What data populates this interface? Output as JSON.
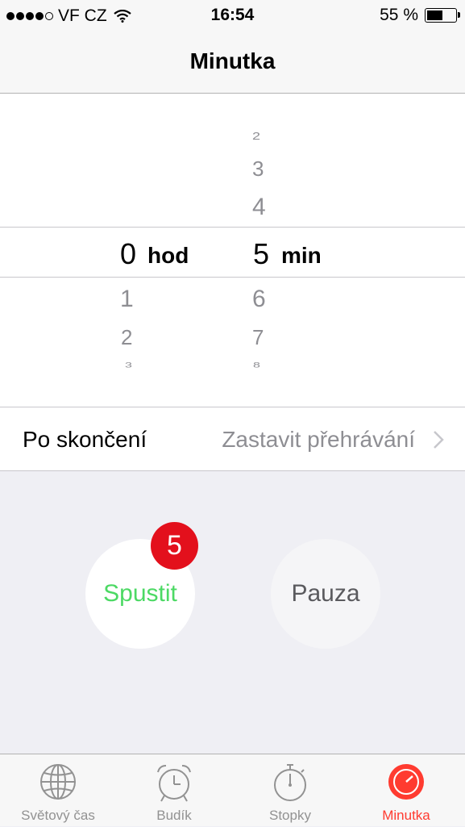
{
  "status_bar": {
    "carrier": "VF CZ",
    "time": "16:54",
    "battery_text": "55 %",
    "battery_level": 0.55
  },
  "nav": {
    "title": "Minutka"
  },
  "picker": {
    "hours": {
      "above": [
        "",
        ""
      ],
      "selected": "0",
      "below": [
        "1",
        "2",
        "3"
      ],
      "unit": "hod"
    },
    "minutes": {
      "above": [
        "2",
        "3",
        "4"
      ],
      "selected": "5",
      "below": [
        "6",
        "7",
        "8"
      ],
      "unit": "min"
    }
  },
  "when_done": {
    "label": "Po skončení",
    "value": "Zastavit přehrávání"
  },
  "buttons": {
    "start": "Spustit",
    "pause": "Pauza",
    "badge": "5"
  },
  "tabs": [
    {
      "label": "Světový čas",
      "icon": "globe-icon"
    },
    {
      "label": "Budík",
      "icon": "alarm-clock-icon"
    },
    {
      "label": "Stopky",
      "icon": "stopwatch-icon"
    },
    {
      "label": "Minutka",
      "icon": "timer-icon",
      "active": true
    }
  ],
  "colors": {
    "accent": "#ff3b30",
    "start": "#4cd964",
    "badge": "#e3101c"
  }
}
